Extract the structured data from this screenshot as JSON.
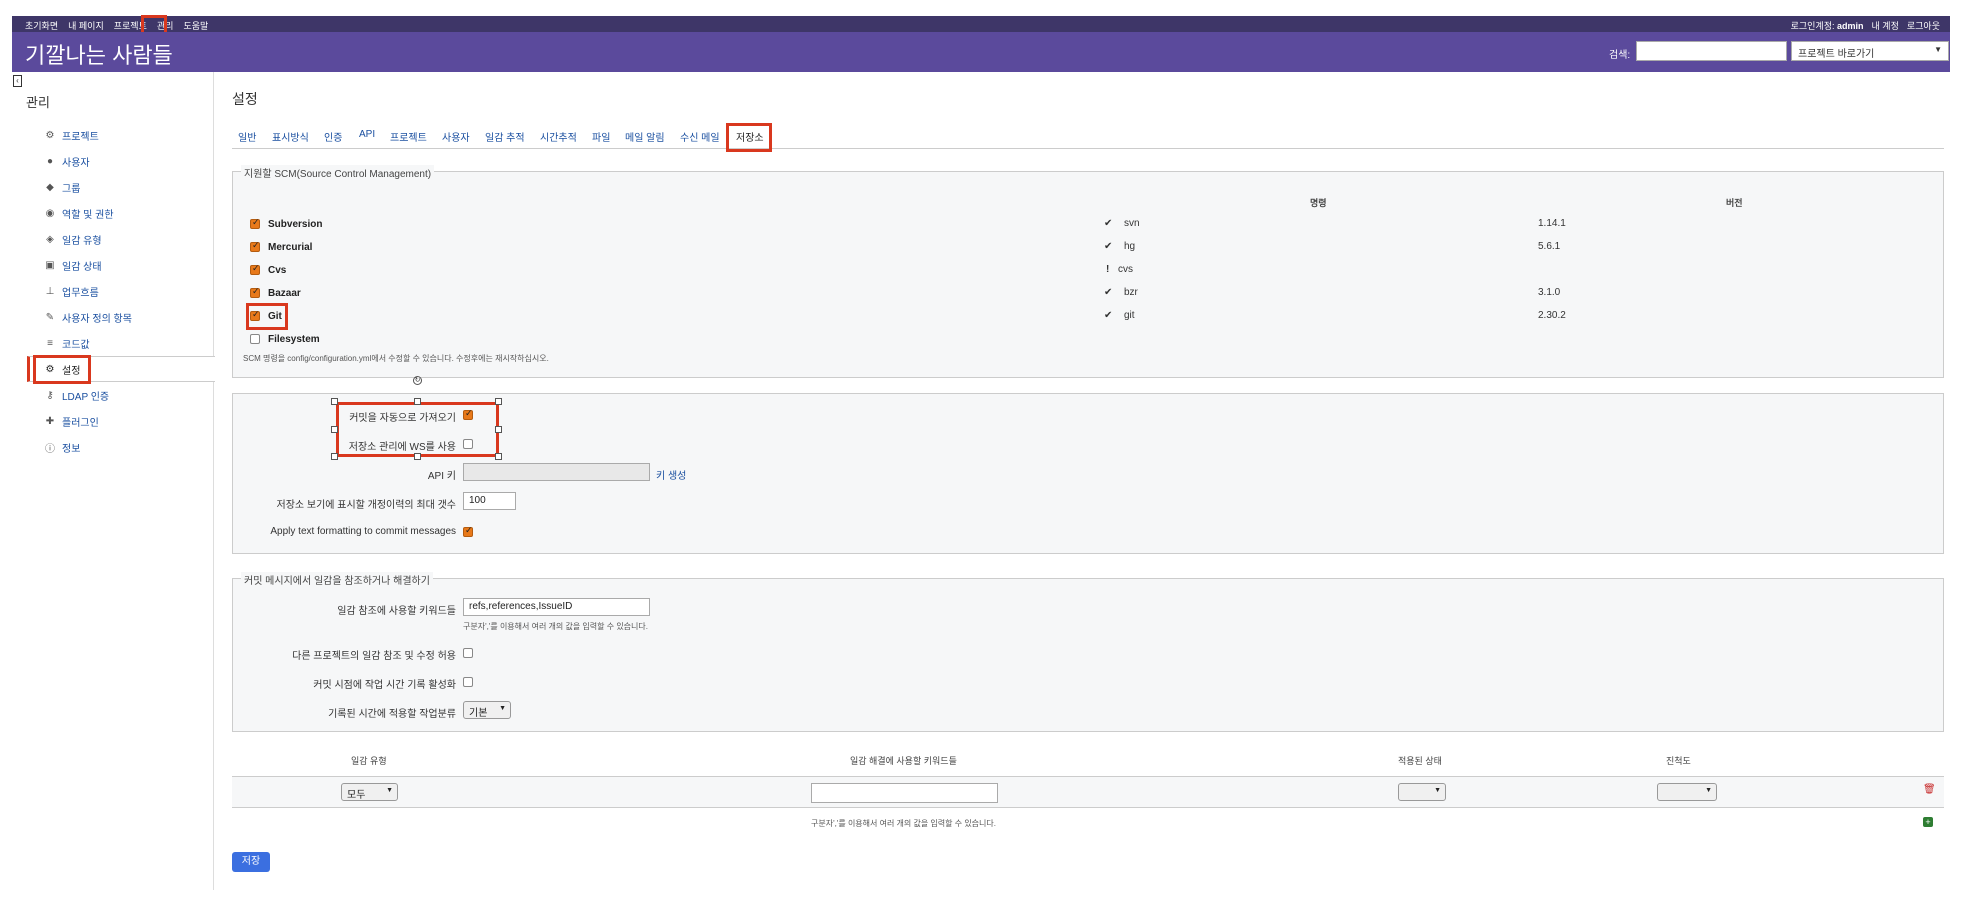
{
  "topbar": {
    "left": [
      "초기화면",
      "내 페이지",
      "프로젝트",
      "관리",
      "도움말"
    ],
    "login_label": "로그인계정:",
    "login_user": "admin",
    "my_account": "내 계정",
    "logout": "로그아웃"
  },
  "header": {
    "title": "기깔나는 사람들",
    "search_label": "검색:",
    "jump_placeholder": "프로젝트 바로가기"
  },
  "sidebar": {
    "title": "관리",
    "items": [
      {
        "label": "프로젝트",
        "icon": "projects-icon"
      },
      {
        "label": "사용자",
        "icon": "user-icon"
      },
      {
        "label": "그룹",
        "icon": "group-icon"
      },
      {
        "label": "역할 및 권한",
        "icon": "eye-icon"
      },
      {
        "label": "일감 유형",
        "icon": "tag-icon"
      },
      {
        "label": "일감 상태",
        "icon": "status-icon"
      },
      {
        "label": "업무흐름",
        "icon": "workflow-icon"
      },
      {
        "label": "사용자 정의 항목",
        "icon": "edit-icon"
      },
      {
        "label": "코드값",
        "icon": "list-icon"
      },
      {
        "label": "설정",
        "icon": "gear-icon"
      },
      {
        "label": "LDAP 인증",
        "icon": "key-icon"
      },
      {
        "label": "플러그인",
        "icon": "plugin-icon"
      },
      {
        "label": "정보",
        "icon": "info-icon"
      }
    ]
  },
  "main": {
    "title": "설정",
    "tabs": [
      "일반",
      "표시방식",
      "인증",
      "API",
      "프로젝트",
      "사용자",
      "일감 추적",
      "시간추적",
      "파일",
      "메일 알림",
      "수신 메일",
      "저장소"
    ]
  },
  "scm": {
    "legend": "지원할 SCM(Source Control Management)",
    "col_command": "명령",
    "col_version": "버전",
    "rows": [
      {
        "name": "Subversion",
        "checked": true,
        "status": "✔",
        "command": "svn",
        "version": "1.14.1"
      },
      {
        "name": "Mercurial",
        "checked": true,
        "status": "✔",
        "command": "hg",
        "version": "5.6.1"
      },
      {
        "name": "Cvs",
        "checked": true,
        "status": "!",
        "command": "cvs",
        "version": ""
      },
      {
        "name": "Bazaar",
        "checked": true,
        "status": "✔",
        "command": "bzr",
        "version": "3.1.0"
      },
      {
        "name": "Git",
        "checked": true,
        "status": "✔",
        "command": "git",
        "version": "2.30.2"
      },
      {
        "name": "Filesystem",
        "checked": false,
        "status": "",
        "command": "",
        "version": ""
      }
    ],
    "hint": "SCM 명령을 config/configuration.yml에서 수정할 수 있습니다. 수정후에는 재시작하십시오."
  },
  "repo_settings": {
    "auto_fetch_label": "커밋을 자동으로 가져오기",
    "auto_fetch": true,
    "ws_label": "저장소 관리에 WS를 사용",
    "ws": false,
    "api_key_label": "API 키",
    "api_key_value": "",
    "generate_key": "키 생성",
    "max_rev_label": "저장소 보기에 표시할 개정이력의 최대 갯수",
    "max_rev_value": "100",
    "text_format_label": "Apply text formatting to commit messages",
    "text_format": true
  },
  "refs": {
    "legend": "커밋 메시지에서 일감을 참조하거나 해결하기",
    "keywords_label": "일감 참조에 사용할 키워드들",
    "keywords_value": "refs,references,IssueID",
    "keywords_hint": "구분자','를 이용해서 여러 개의 값을 입력할 수 있습니다.",
    "cross_project_label": "다른 프로젝트의 일감 참조 및 수정 허용",
    "cross_project": false,
    "time_log_label": "커밋 시점에 작업 시간 기록 활성화",
    "time_log": false,
    "activity_label": "기록된 시간에 적용할 작업분류",
    "activity_value": "기본"
  },
  "fix_table": {
    "col_tracker": "일감 유형",
    "col_keywords": "일감 해결에 사용할 키워드들",
    "col_status": "적용된 상태",
    "col_done": "진척도",
    "tracker_value": "모두",
    "hint": "구분자','를 이용해서 여러 개의 값을 입력할 수 있습니다."
  },
  "save_label": "저장"
}
